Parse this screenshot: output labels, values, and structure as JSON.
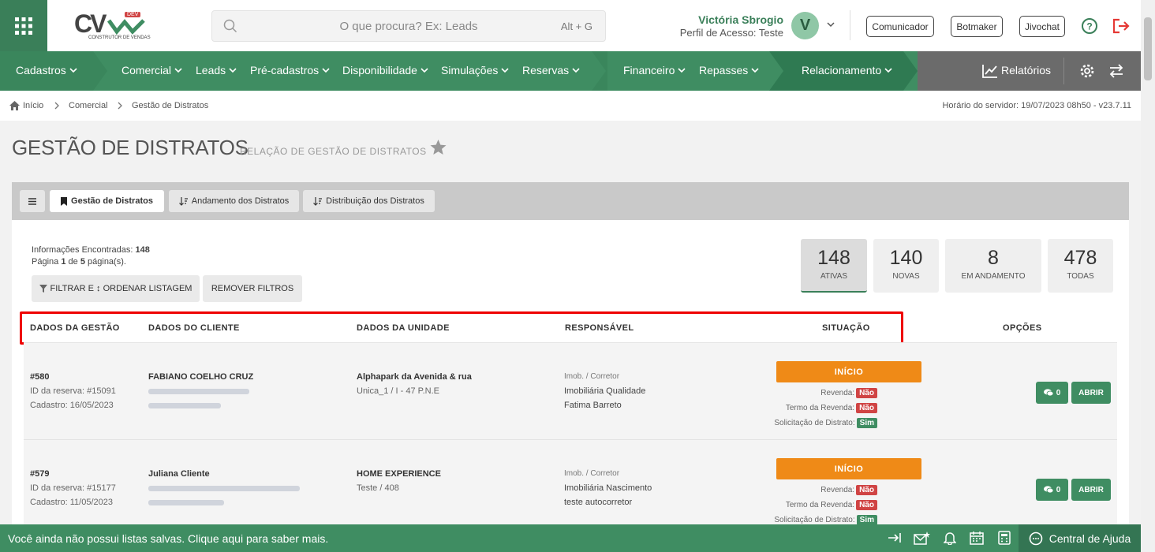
{
  "header": {
    "search_placeholder": "O que procura? Ex: Leads",
    "search_shortcut": "Alt + G",
    "logo_text": "CV",
    "logo_sub": "CONSTRUTOR DE VENDAS",
    "logo_badge": "DEV",
    "user_name": "Victória Sbrogio",
    "user_profile": "Perfil de Acesso: Teste",
    "avatar_initial": "V",
    "buttons": [
      "Comunicador",
      "Botmaker",
      "Jivochat"
    ]
  },
  "nav": {
    "items": [
      "Cadastros",
      "Comercial",
      "Leads",
      "Pré-cadastros",
      "Disponibilidade",
      "Simulações",
      "Reservas",
      "Financeiro",
      "Repasses",
      "Relacionamento"
    ],
    "reports": "Relatórios"
  },
  "breadcrumb": [
    "Início",
    "Comercial",
    "Gestão de Distratos"
  ],
  "server_time": "Horário do servidor: 19/07/2023 08h50 - v23.7.11",
  "page": {
    "title": "GESTÃO DE DISTRATOS",
    "subtitle": "RELAÇÃO DE GESTÃO DE DISTRATOS"
  },
  "tabs": [
    "Gestão de Distratos",
    "Andamento dos Distratos",
    "Distribuição dos Distratos"
  ],
  "info": {
    "found_label": "Informações Encontradas:",
    "found_value": "148",
    "page_prefix": "Página",
    "page_current": "1",
    "page_mid": "de",
    "page_total": "5",
    "page_suffix": "página(s)."
  },
  "filter_button": "FILTRAR E ↕ ORDENAR LISTAGEM",
  "remove_filters_button": "REMOVER FILTROS",
  "stats": [
    {
      "value": "148",
      "label": "ATIVAS"
    },
    {
      "value": "140",
      "label": "NOVAS"
    },
    {
      "value": "8",
      "label": "EM ANDAMENTO"
    },
    {
      "value": "478",
      "label": "TODAS"
    }
  ],
  "table": {
    "headers": [
      "DADOS DA GESTÃO",
      "DADOS DO CLIENTE",
      "DADOS DA UNIDADE",
      "RESPONSÁVEL",
      "SITUAÇÃO",
      "OPÇÕES"
    ],
    "rows": [
      {
        "id": "#580",
        "reserva": "ID da reserva: #15091",
        "cadastro": "Cadastro: 16/05/2023",
        "cliente": "FABIANO COELHO CRUZ",
        "unidade": "Alphapark da Avenida & rua",
        "unidade_det": "Unica_1 / I - 47 P.N.E",
        "resp_label": "Imob. / Corretor",
        "imobiliaria": "Imobiliária Qualidade",
        "corretor": "Fatima Barreto",
        "status": "INÍCIO",
        "revenda_label": "Revenda:",
        "revenda": "Não",
        "termo_label": "Termo da Revenda:",
        "termo": "Não",
        "solicitacao_label": "Solicitação de Distrato:",
        "solicitacao": "Sim",
        "comments": "0",
        "open": "ABRIR"
      },
      {
        "id": "#579",
        "reserva": "ID da reserva: #15177",
        "cadastro": "Cadastro: 11/05/2023",
        "cliente": "Juliana Cliente",
        "unidade": "HOME EXPERIENCE",
        "unidade_det": "Teste / 408",
        "resp_label": "Imob. / Corretor",
        "imobiliaria": "Imobiliária Nascimento",
        "corretor": "teste autocorretor",
        "status": "INÍCIO",
        "revenda_label": "Revenda:",
        "revenda": "Não",
        "termo_label": "Termo da Revenda:",
        "termo": "Não",
        "solicitacao_label": "Solicitação de Distrato:",
        "solicitacao": "Sim",
        "comments": "0",
        "open": "ABRIR"
      }
    ]
  },
  "footer": {
    "message": "Você ainda não possui listas salvas. Clique aqui para saber mais.",
    "help": "Central de Ajuda"
  }
}
